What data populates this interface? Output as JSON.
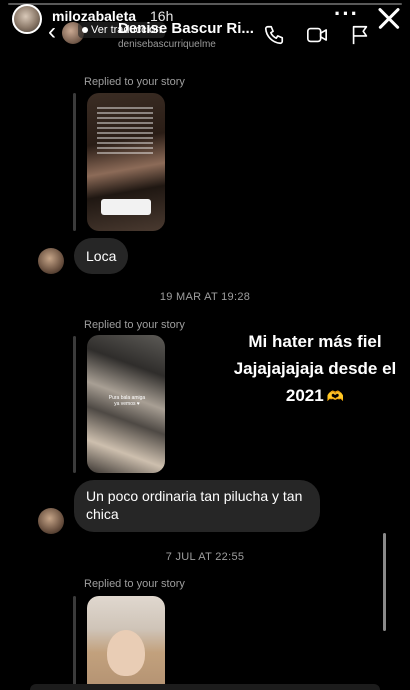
{
  "story": {
    "username": "milozabaleta",
    "time": "16h",
    "more_label": "···"
  },
  "dm_header": {
    "translate_label": "Ver traducción",
    "name": "Denise Bascur Ri...",
    "handle": "denisebascurriquelme"
  },
  "icons": {
    "back": "chevron-left-icon",
    "phone": "phone-icon",
    "video": "video-camera-icon",
    "flag": "flag-icon",
    "close": "close-icon",
    "heart_hands": "heart-hands-icon"
  },
  "messages": [
    {
      "replied_label": "Replied to your story",
      "text": "Loca"
    },
    {
      "replied_label": "Replied to your story",
      "text": "Un poco ordinaria tan pilucha y tan chica"
    },
    {
      "replied_label": "Replied to your story"
    }
  ],
  "timestamps": [
    "19 MAR AT 19:28",
    "7 JUL AT 22:55"
  ],
  "story_thumb_2_caption": "Pura bala amiga ya vemos ♥",
  "overlay_caption": "Mi hater más fiel Jajajajajaja desde el 2021",
  "overlay_emoji": "🫶"
}
